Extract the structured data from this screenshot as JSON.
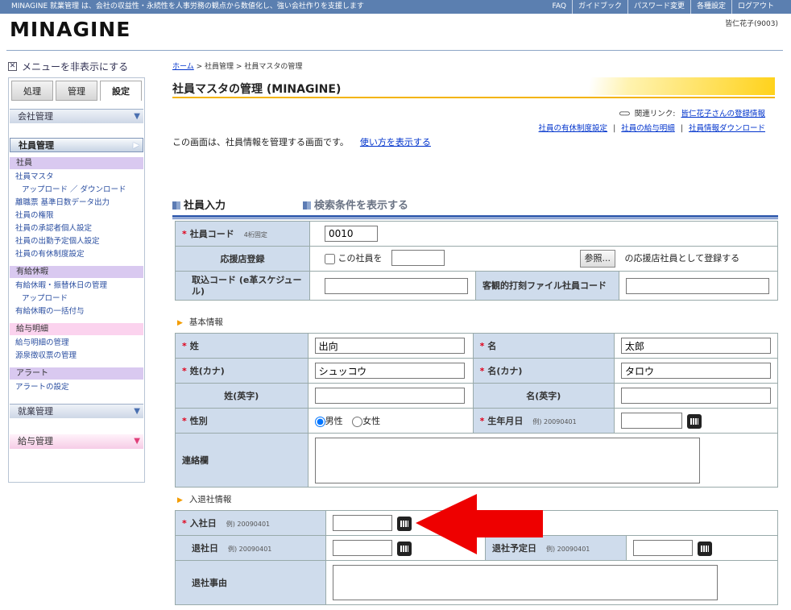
{
  "topbar": {
    "tagline": "MINAGINE 就業管理 は、会社の収益性・永続性を人事労務の観点から数値化し、強い会社作りを支援します",
    "links": [
      "FAQ",
      "ガイドブック",
      "パスワード変更",
      "各種設定",
      "ログアウト"
    ]
  },
  "logo": "MINAGINE",
  "user": "皆仁花子(9003)",
  "sidebar": {
    "toggle": "メニューを非表示にする",
    "tabs": [
      "処理",
      "管理",
      "設定"
    ],
    "company": "会社管理",
    "employee_mgmt": "社員管理",
    "cat_employee": "社員",
    "employee_items": [
      "社員マスタ",
      "アップロード ／ ダウンロード",
      "離職票 基準日数データ出力",
      "社員の権限",
      "社員の承認者個人設定",
      "社員の出勤予定個人設定",
      "社員の有休制度設定"
    ],
    "cat_leave": "有給休暇",
    "leave_items": [
      "有給休暇・振替休日の管理",
      "アップロード",
      "有給休暇の一括付与"
    ],
    "cat_payslip": "給与明細",
    "payslip_items": [
      "給与明細の管理",
      "源泉徴収票の管理"
    ],
    "cat_alert": "アラート",
    "alert_items": [
      "アラートの設定"
    ],
    "work_mgmt": "就業管理",
    "payroll_mgmt": "給与管理"
  },
  "breadcrumb": {
    "home": "ホーム",
    "b1": "社員管理",
    "b2": "社員マスタの管理"
  },
  "page_title": "社員マスタの管理 (MINAGINE)",
  "related": {
    "label": "関連リンク:",
    "link": "皆仁花子さんの登録情報",
    "links2": [
      "社員の有休制度設定",
      "社員の給与明細",
      "社員情報ダウンロード"
    ]
  },
  "description": "この画面は、社員情報を管理する画面です。",
  "howto": "使い方を表示する",
  "section_input": "社員入力",
  "section_search": "検索条件を表示する",
  "form": {
    "code_label": "社員コード",
    "code_hint": "4桁固定",
    "code_value": "0010",
    "support_label": "応援店登録",
    "support_check": "この社員を",
    "ref_button": "参照...",
    "support_suffix": "の応援店社員として登録する",
    "import_label": "取込コード (e革スケジュール)",
    "objective_label": "客観的打刻ファイル社員コード",
    "basic_title": "基本情報",
    "last_label": "姓",
    "last_value": "出向",
    "first_label": "名",
    "first_value": "太郎",
    "last_kana_label": "姓(カナ)",
    "last_kana_value": "シュッコウ",
    "first_kana_label": "名(カナ)",
    "first_kana_value": "タロウ",
    "last_en_label": "姓(英字)",
    "first_en_label": "名(英字)",
    "gender_label": "性別",
    "male": "男性",
    "female": "女性",
    "birth_label": "生年月日",
    "example": "例) 20090401",
    "contact_label": "連絡欄",
    "join_title": "入退社情報",
    "join_label": "入社日",
    "leave_label": "退社日",
    "leave_plan_label": "退社予定日",
    "reason_label": "退社事由"
  }
}
